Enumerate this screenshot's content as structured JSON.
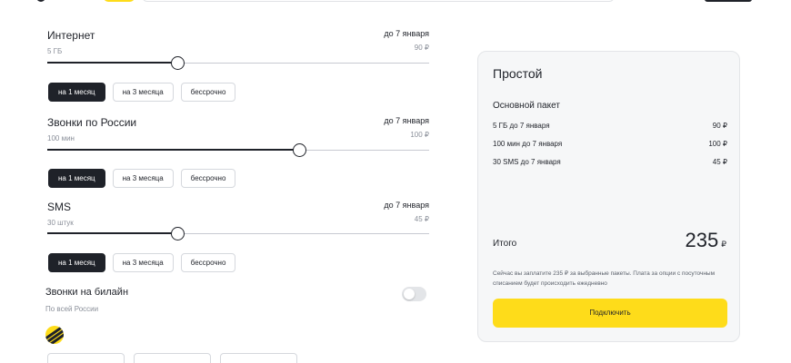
{
  "options": [
    {
      "title": "Интернет",
      "amount": "5 ГБ",
      "date": "до 7 января",
      "price": "90 ₽",
      "level_percent": 34
    },
    {
      "title": "Звонки по России",
      "amount": "100 мин",
      "date": "до 7 января",
      "price": "100 ₽",
      "level_percent": 66
    },
    {
      "title": "SMS",
      "amount": "30 штук",
      "date": "до 7 января",
      "price": "45 ₽",
      "level_percent": 34
    }
  ],
  "periods": [
    "на 1 месяц",
    "на 3 месяца",
    "бессрочно"
  ],
  "selected_period": "на 1 месяц",
  "beeline": {
    "title": "Звонки на билайн",
    "sub": "По всей России",
    "toggle_on": false
  },
  "summary": {
    "title": "Простой",
    "package_title": "Основной пакет",
    "items": [
      {
        "name": "5 ГБ до 7 января",
        "price": "90 ₽"
      },
      {
        "name": "100 мин до 7 января",
        "price": "100 ₽"
      },
      {
        "name": "30 SMS до 7 января",
        "price": "45 ₽"
      }
    ],
    "total_label": "Итого",
    "total_value": "235",
    "currency": "₽",
    "note": "Сейчас вы заплатите 235 ₽ за выбранные пакеты. Плата за опции с посуточным списанием будет происходить ежедневно",
    "button": "Подключить"
  },
  "colors": {
    "accent": "#fedc1a",
    "dark": "#1f2229",
    "card_bg": "#f6f7f8"
  },
  "icons": {
    "brand": "beeline-logo-icon"
  }
}
